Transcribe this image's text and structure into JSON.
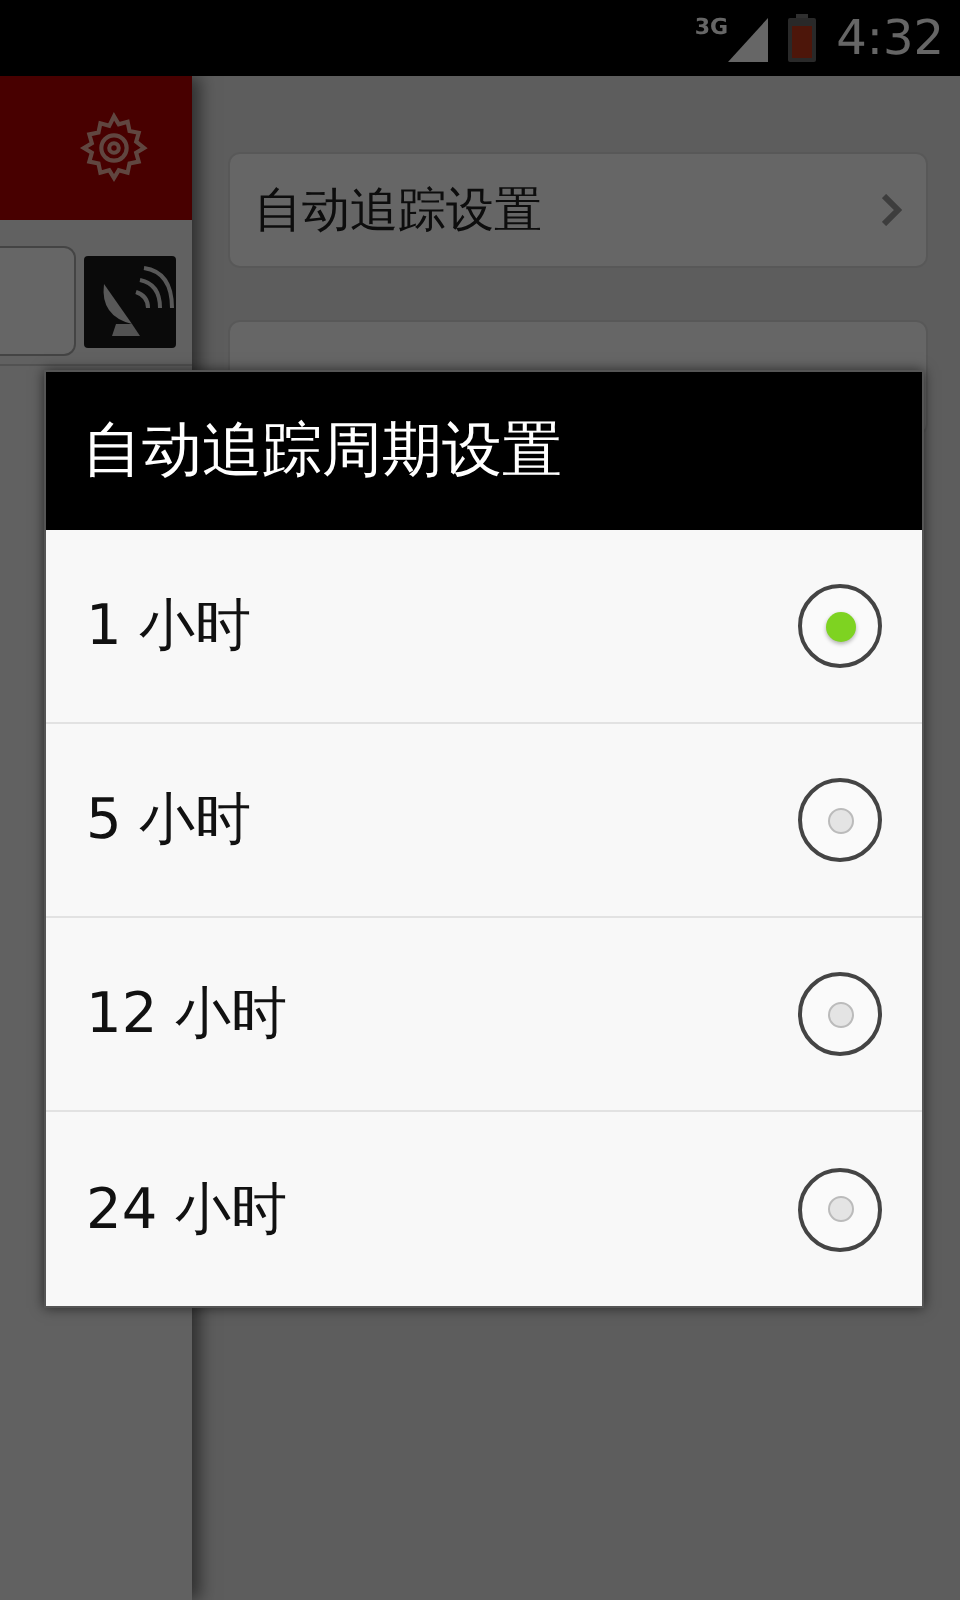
{
  "status_bar": {
    "network": "3G",
    "time": "4:32"
  },
  "settings": [
    {
      "label": "自动追踪设置"
    }
  ],
  "dialog": {
    "title": "自动追踪周期设置",
    "options": [
      {
        "label": "1 小时",
        "selected": true
      },
      {
        "label": "5 小时",
        "selected": false
      },
      {
        "label": "12 小时",
        "selected": false
      },
      {
        "label": "24 小时",
        "selected": false
      }
    ]
  }
}
